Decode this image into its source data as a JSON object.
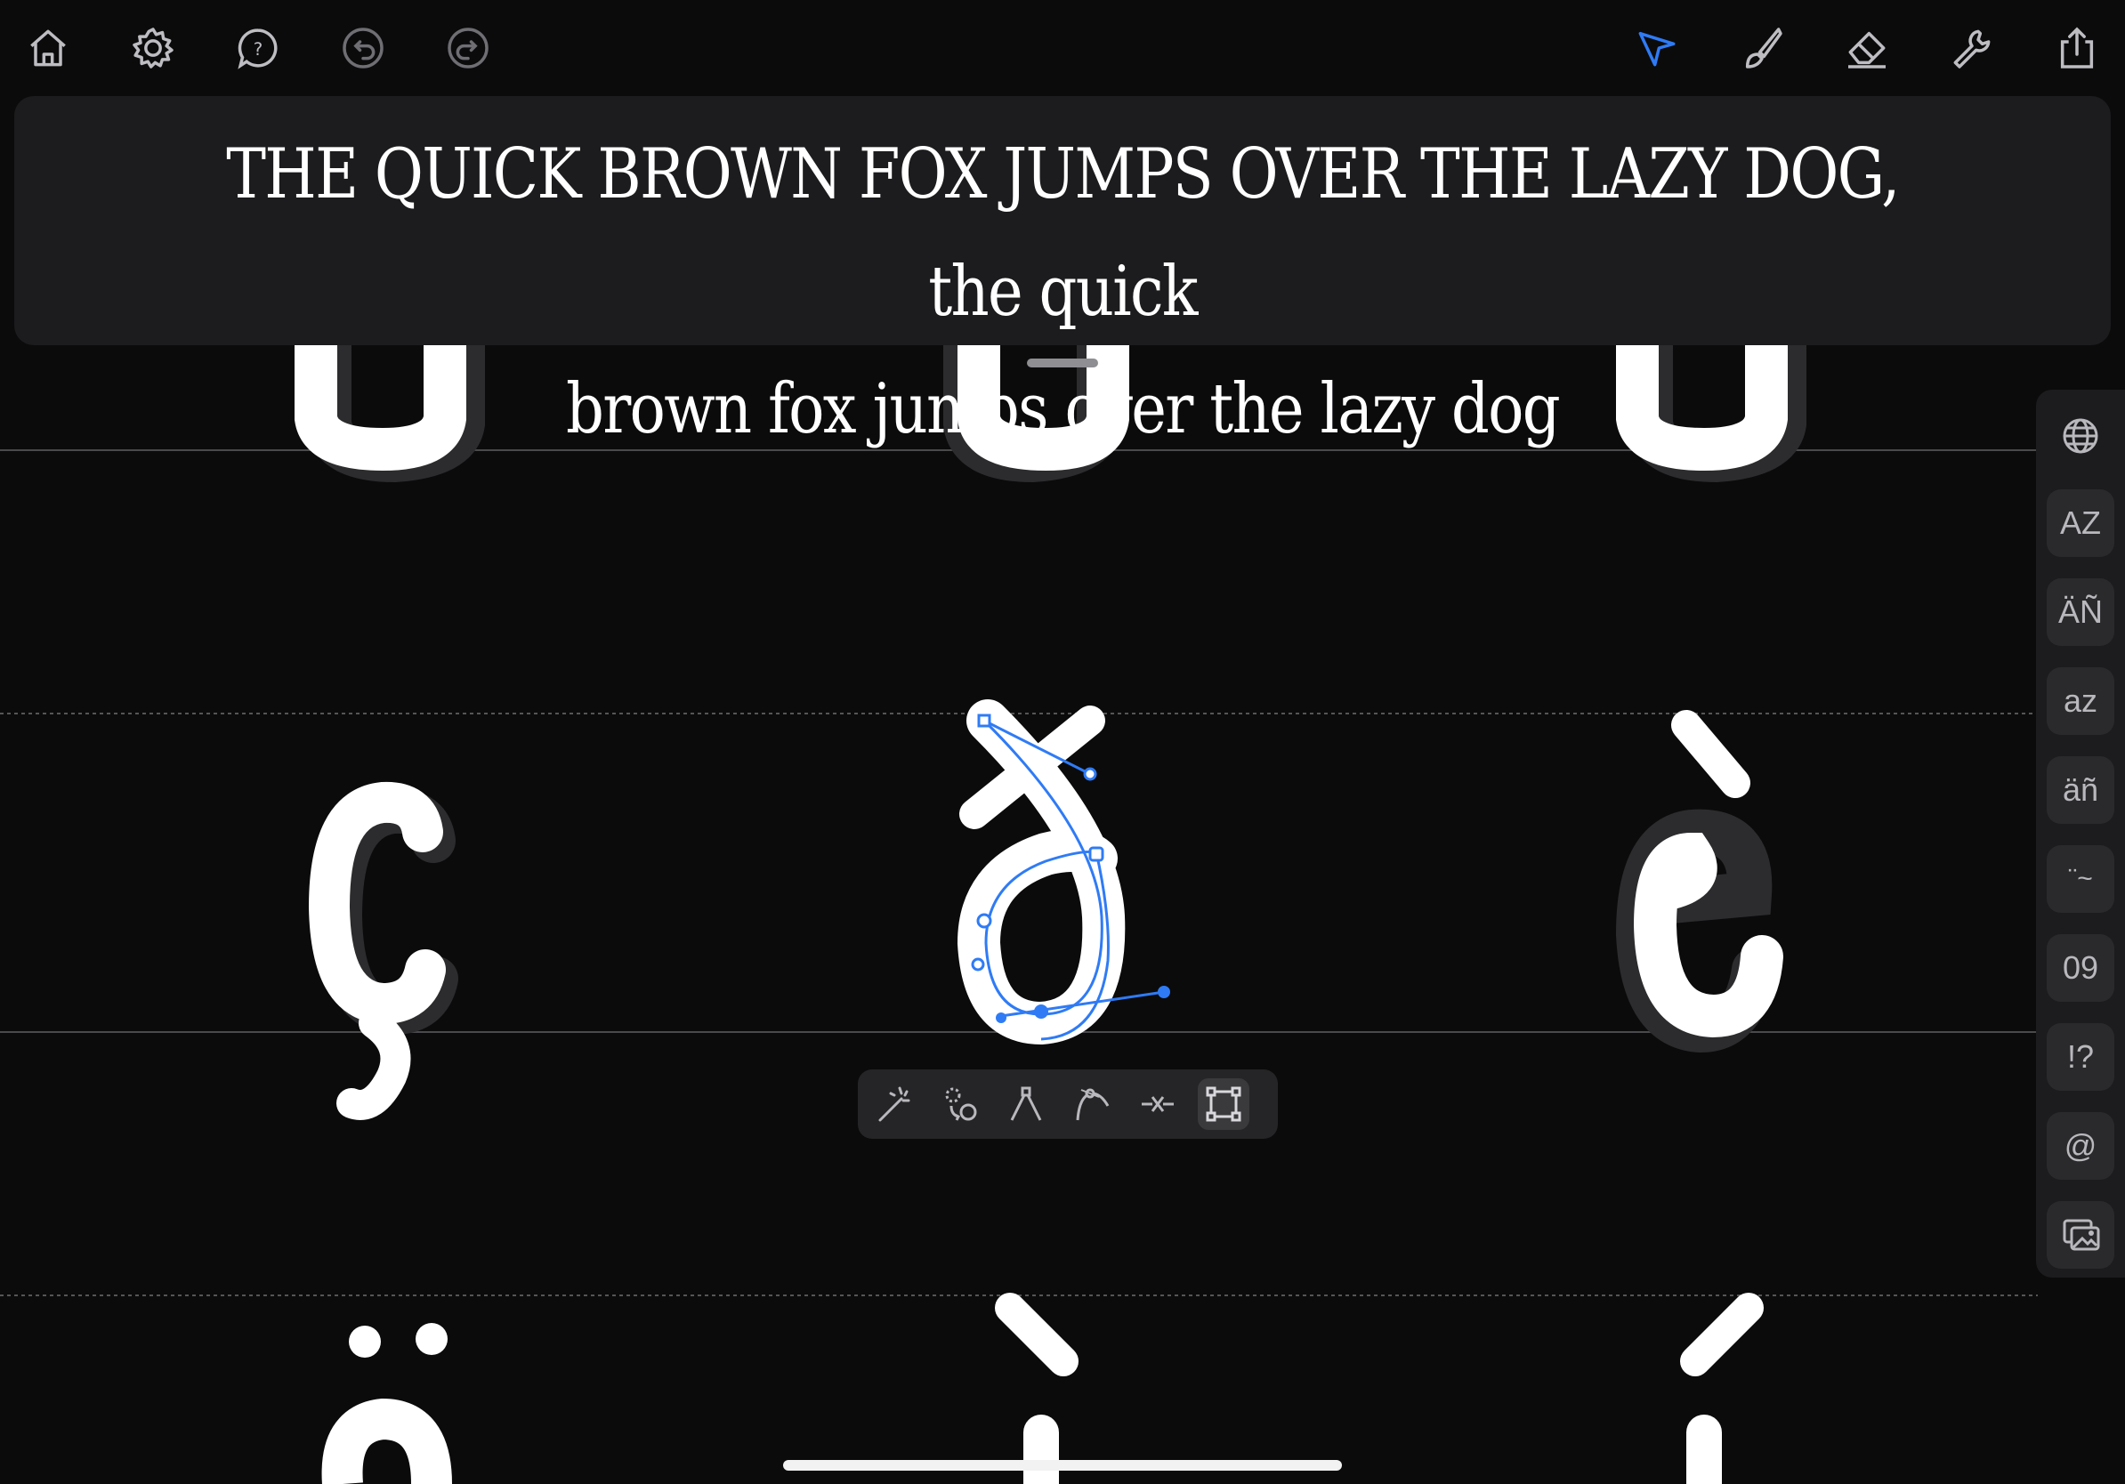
{
  "toolbar": {
    "left_icons": [
      "home-icon",
      "gear-icon",
      "help-bubble-icon",
      "undo-icon",
      "redo-icon"
    ],
    "right_icons": [
      "pointer-icon",
      "brush-icon",
      "eraser-icon",
      "wrench-icon",
      "share-icon"
    ],
    "active_tool": "pointer-icon",
    "accent_color": "#2f7bf5"
  },
  "preview": {
    "line1": "THE QUICK BROWN FOX JUMPS OVER THE LAZY DOG, the quick",
    "line2": "brown fox jumps over the lazy dog"
  },
  "glyphs": {
    "row1": [
      "u",
      "u",
      "u"
    ],
    "row2": [
      "ç",
      "ð",
      "è"
    ],
    "row3": [
      "ö",
      "ì",
      "í"
    ],
    "selected": "ð"
  },
  "side_panel": {
    "buttons": [
      {
        "name": "globe-icon",
        "label": ""
      },
      {
        "name": "uppercase",
        "label": "AZ"
      },
      {
        "name": "uppercase-accented",
        "label": "ÄÑ"
      },
      {
        "name": "lowercase",
        "label": "az"
      },
      {
        "name": "lowercase-accented",
        "label": "äñ"
      },
      {
        "name": "diacritics",
        "label": "¨~"
      },
      {
        "name": "numbers",
        "label": "09"
      },
      {
        "name": "punctuation",
        "label": "!?"
      },
      {
        "name": "symbols",
        "label": "@"
      },
      {
        "name": "image-icon",
        "label": ""
      }
    ]
  },
  "node_toolbar": {
    "tools": [
      "magic-wand-icon",
      "convert-point-icon",
      "corner-point-icon",
      "curve-point-icon",
      "split-point-icon",
      "transform-box-icon"
    ],
    "active": "transform-box-icon"
  }
}
